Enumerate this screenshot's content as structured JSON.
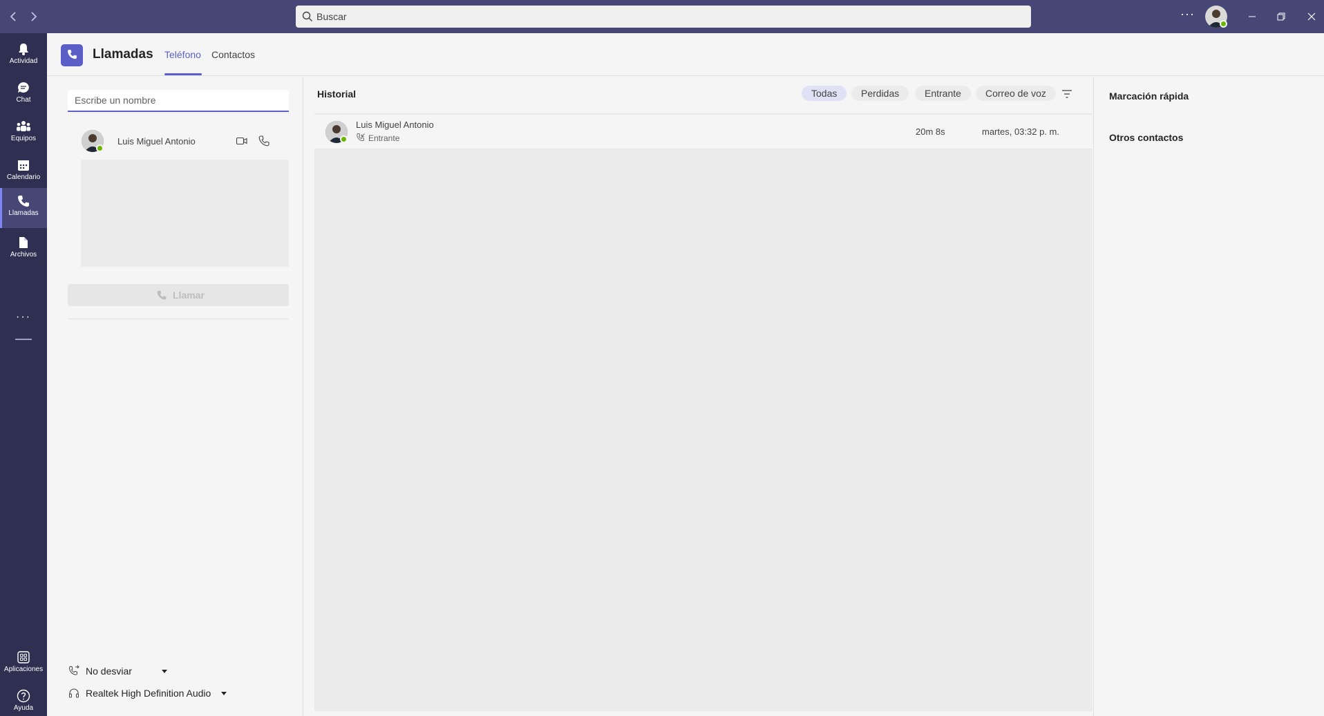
{
  "titlebar": {
    "back_icon": "chevron-left-icon",
    "forward_icon": "chevron-right-icon",
    "search_placeholder": "Buscar",
    "more_label": "···",
    "accent": "#464775"
  },
  "rail": {
    "items": [
      {
        "label": "Actividad",
        "icon": "bell-icon"
      },
      {
        "label": "Chat",
        "icon": "chat-icon"
      },
      {
        "label": "Equipos",
        "icon": "teams-icon"
      },
      {
        "label": "Calendario",
        "icon": "calendar-icon"
      },
      {
        "label": "Llamadas",
        "icon": "phone-icon",
        "active": true
      },
      {
        "label": "Archivos",
        "icon": "file-icon"
      }
    ],
    "more": "···",
    "apps_label": "Aplicaciones",
    "help_label": "Ayuda"
  },
  "header": {
    "title": "Llamadas",
    "tabs": [
      {
        "label": "Teléfono",
        "active": true
      },
      {
        "label": "Contactos",
        "active": false
      }
    ]
  },
  "dial": {
    "name_placeholder": "Escribe un nombre",
    "contact_name": "Luis Miguel Antonio",
    "call_label": "Llamar",
    "forwarding_label": "No desviar",
    "audio_device_label": "Realtek High Definition Audio"
  },
  "history": {
    "title": "Historial",
    "filters": [
      "Todas",
      "Perdidas",
      "Entrante",
      "Correo de voz"
    ],
    "rows": [
      {
        "name": "Luis Miguel Antonio",
        "type": "Entrante",
        "duration": "20m 8s",
        "date": "martes, 03:32 p. m."
      }
    ]
  },
  "right": {
    "speed_dial": "Marcación rápida",
    "other_contacts": "Otros contactos"
  },
  "colors": {
    "brand": "#5b5fc7",
    "rail": "#2f2f52",
    "presence_available": "#6bb700"
  }
}
